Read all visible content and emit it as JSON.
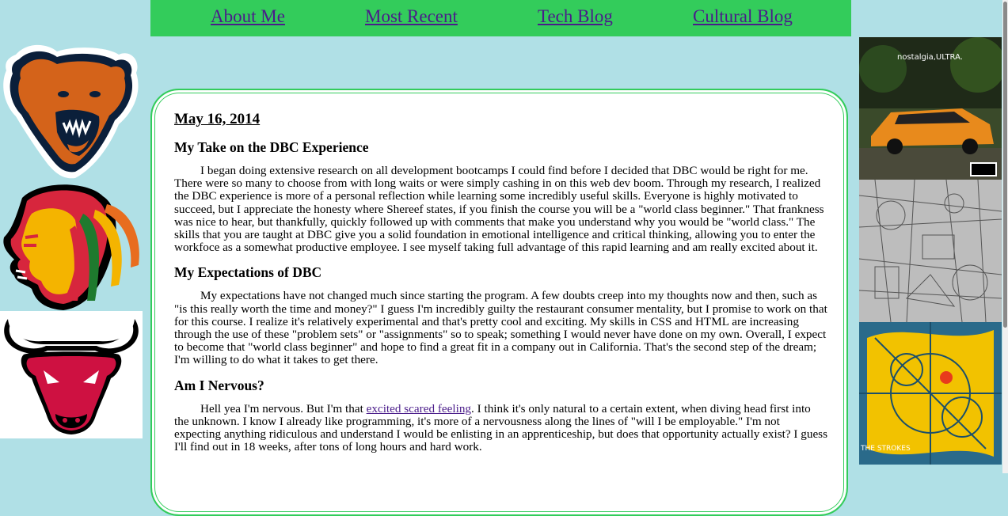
{
  "nav": {
    "about": "About Me",
    "recent": "Most Recent",
    "tech": "Tech Blog",
    "cultural": "Cultural Blog"
  },
  "post": {
    "date": "May 16, 2014",
    "sections": [
      {
        "heading": "My Take on the DBC Experience",
        "body": "I began doing extensive research on all development bootcamps I could find before I decided that DBC would be right for me. There were so many to choose from with long waits or were simply cashing in on this web dev boom. Through my research, I realized the DBC experience is more of a personal reflection while learning some incredibly useful skills. Everyone is highly motivated to succeed, but I appreciate the honesty where Shereef states, if you finish the course you will be a \"world class beginner.\" That frankness was nice to hear, but thankfully, quickly followed up with comments that make you understand why you would be \"world class.\" The skills that you are taught at DBC give you a solid foundation in emotional intelligence and critical thinking, allowing you to enter the workfoce as a somewhat productive employee. I see myself taking full advantage of this rapid learning and am really excited about it."
      },
      {
        "heading": "My Expectations of DBC",
        "body": "My expectations have not changed much since starting the program. A few doubts creep into my thoughts now and then, such as \"is this really worth the time and money?\" I guess I'm incredibly guilty the restaurant consumer mentality, but I promise to work on that for this course. I realize it's relatively experimental and that's pretty cool and exciting. My skills in CSS and HTML are increasing through the use of these \"problem sets\" or \"assignments\" so to speak; something I would never have done on my own. Overall, I expect to become that \"world class beginner\" and hope to find a great fit in a company out in California. That's the second step of the dream; I'm willing to do what it takes to get there."
      },
      {
        "heading": "Am I Nervous?",
        "body_before": "Hell yea I'm nervous. But I'm that ",
        "link": "excited scared feeling",
        "body_after": ". I think it's only natural to a certain extent, when diving head first into the unknown. I know I already like programming, it's more of a nervousness along the lines of \"will I be employable.\" I'm not expecting anything ridiculous and understand I would be enlisting in an apprenticeship, but does that opportunity actually exist? I guess I'll find out in 18 weeks, after tons of long hours and hard work."
      }
    ]
  },
  "sidebar_left": {
    "logos": [
      "chicago-bears-logo",
      "chicago-blackhawks-logo",
      "chicago-bulls-logo"
    ]
  },
  "sidebar_right": {
    "albums": [
      {
        "icon": "nostalgia-ultra-album-cover",
        "title": "nostalgia,ULTRA.",
        "badge": "PARENTAL ADVISORY EXPLICIT CONTENT"
      },
      {
        "icon": "sketch-album-cover"
      },
      {
        "icon": "the-strokes-album-cover",
        "caption": "THE STROKES"
      }
    ]
  },
  "colors": {
    "background": "#b0e0e6",
    "nav": "#33cc5b",
    "link": "#4a1c8a"
  }
}
